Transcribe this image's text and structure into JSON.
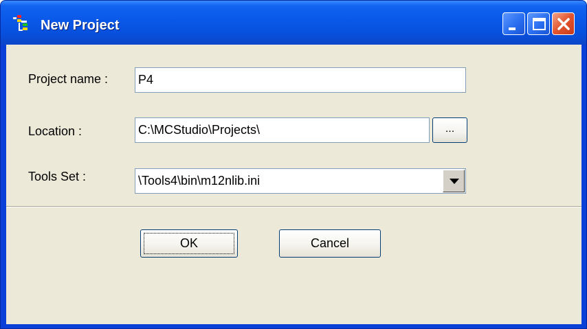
{
  "window": {
    "title": "New Project",
    "controls": {
      "minimize": "minimize-icon",
      "maximize": "maximize-icon",
      "close": "close-icon"
    }
  },
  "form": {
    "project_name": {
      "label": "Project name :",
      "value": "P4"
    },
    "location": {
      "label": "Location :",
      "value": "C:\\MCStudio\\Projects\\",
      "browse_label": "..."
    },
    "tools_set": {
      "label": "Tools Set :",
      "value": "\\Tools4\\bin\\m12nlib.ini"
    }
  },
  "buttons": {
    "ok": "OK",
    "cancel": "Cancel"
  },
  "colors": {
    "title_bar": "#0a58e8",
    "client_bg": "#ece9d8",
    "close_button": "#e3552e"
  }
}
